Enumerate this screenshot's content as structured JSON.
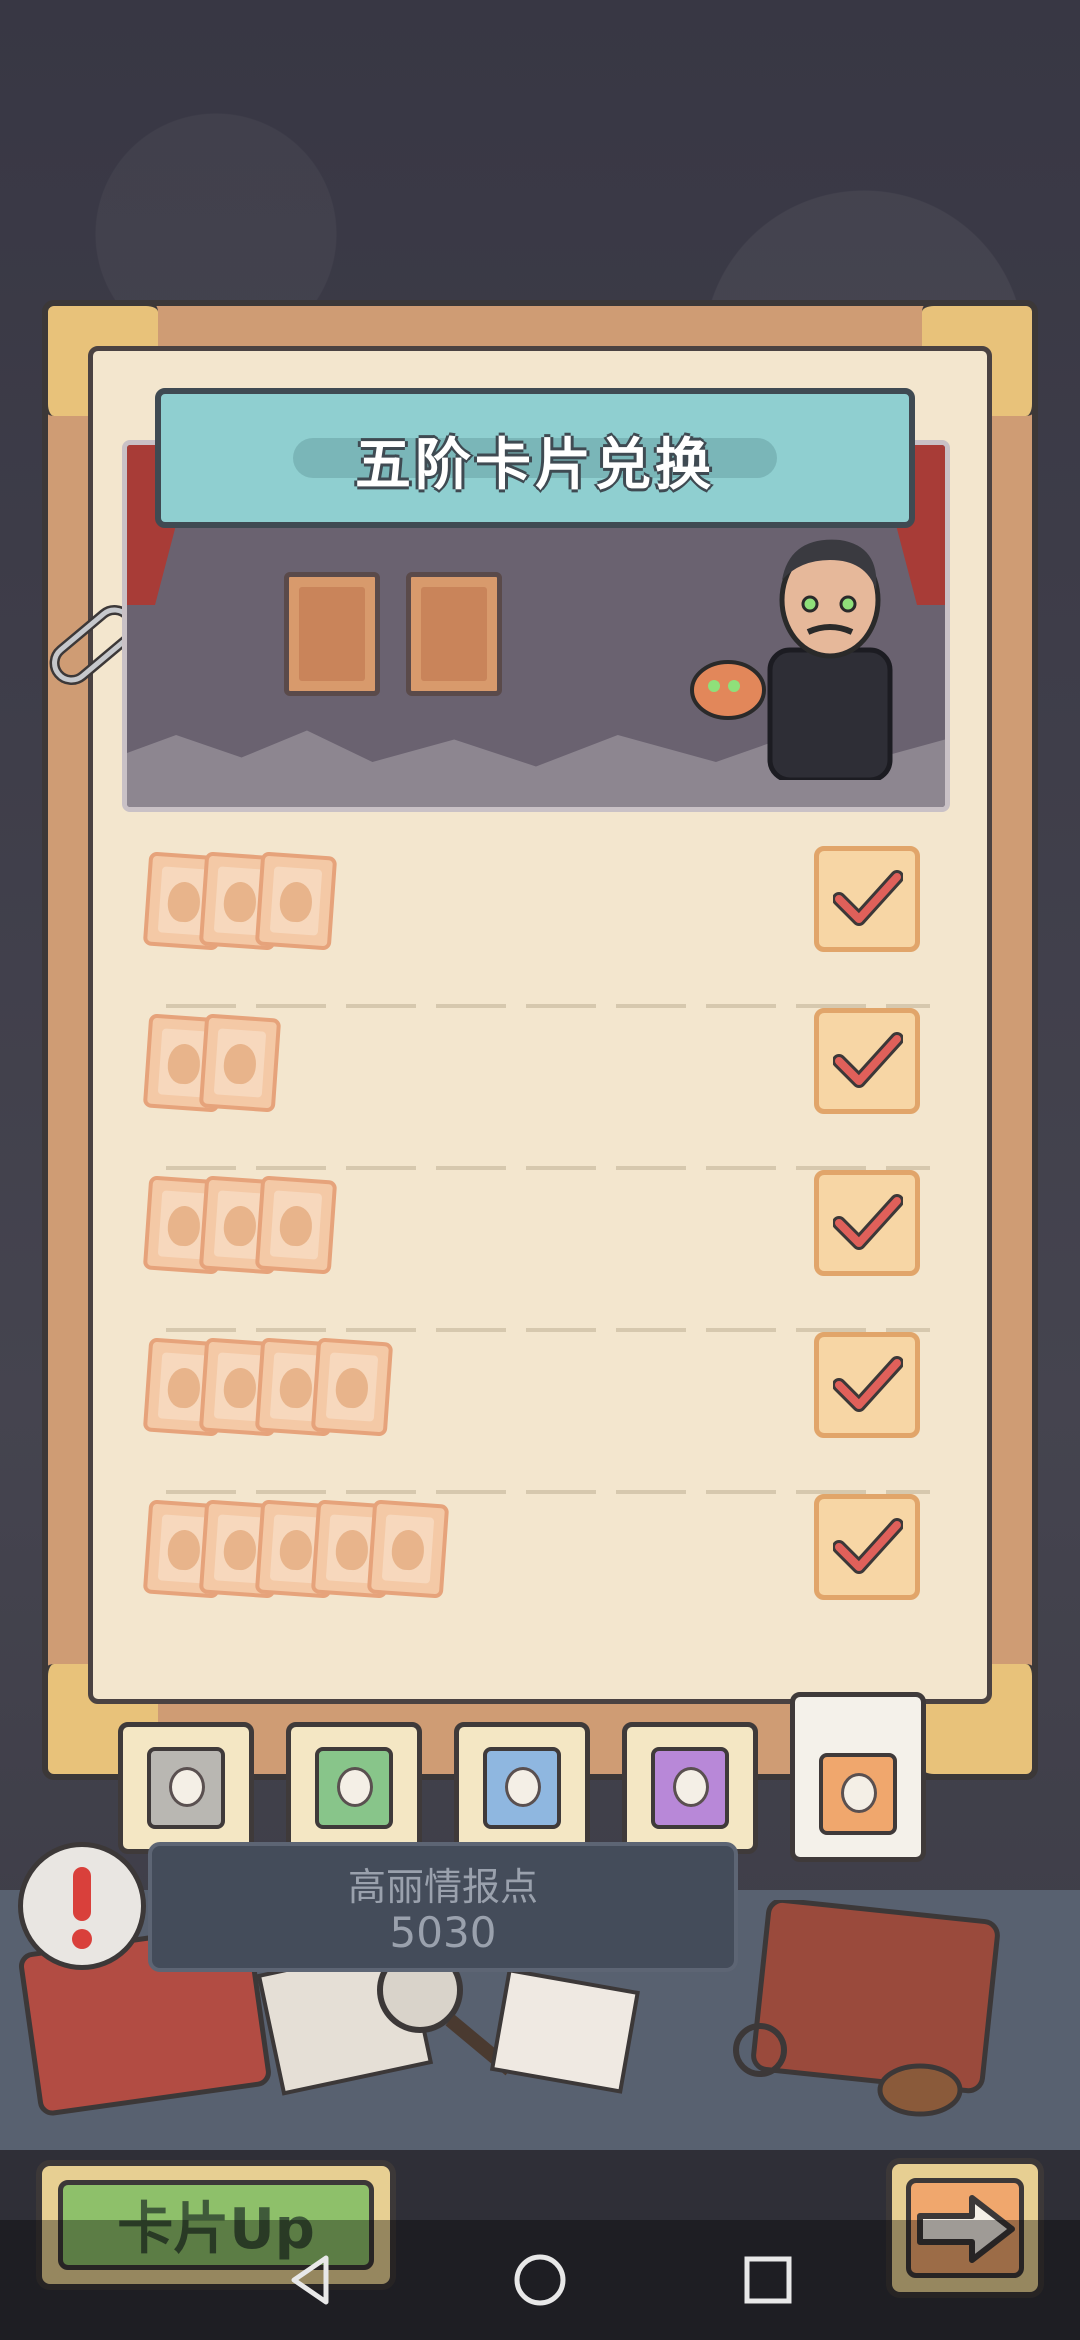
{
  "title": "五阶卡片兑换",
  "points": {
    "label": "高丽情报点",
    "value": "5030"
  },
  "rows": [
    {
      "cards": 3,
      "reward": "check"
    },
    {
      "cards": 2,
      "reward": "check"
    },
    {
      "cards": 3,
      "reward": "check"
    },
    {
      "cards": 4,
      "reward": "check"
    },
    {
      "cards": 5,
      "reward": "check"
    }
  ],
  "tabs": [
    {
      "color": "#b9b7b2"
    },
    {
      "color": "#88c58a"
    },
    {
      "color": "#8fb7e0"
    },
    {
      "color": "#b888d8"
    },
    {
      "color": "#f0a76d",
      "active": true
    }
  ],
  "bottom": {
    "card_up_label": "卡片Up"
  },
  "icons": {
    "alert": "exclamation-icon",
    "clip": "paperclip-icon",
    "next": "arrow-right-icon",
    "nav": [
      "back-triangle-icon",
      "home-circle-icon",
      "recents-square-icon"
    ]
  },
  "colors": {
    "accent_teal": "#8fcfd0",
    "check_red": "#e0605a"
  }
}
